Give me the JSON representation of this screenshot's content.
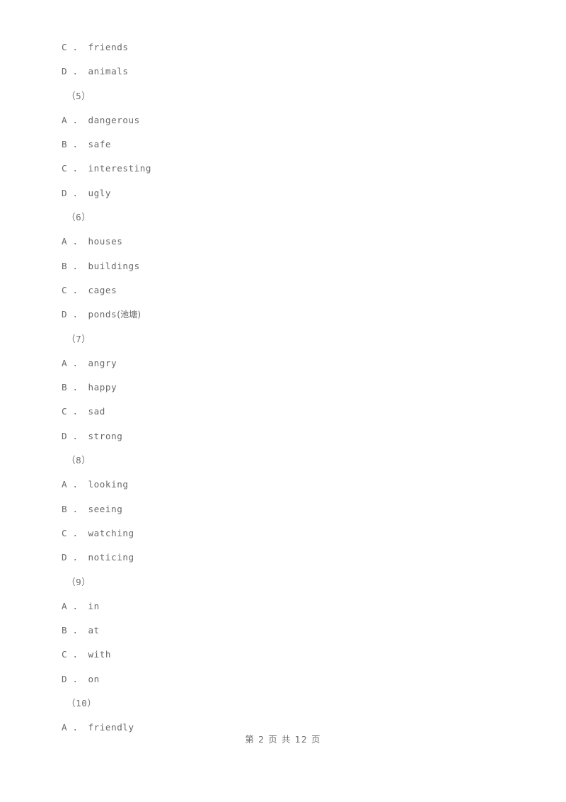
{
  "document": {
    "type": "scanned-exam-worksheet",
    "background_color": "#ffffff",
    "text_color": "#6b6b6b"
  },
  "lines": [
    {
      "kind": "option",
      "text": "C ． friends"
    },
    {
      "kind": "option",
      "text": "D ． animals"
    },
    {
      "kind": "question",
      "text": "（5）"
    },
    {
      "kind": "option",
      "text": "A ． dangerous"
    },
    {
      "kind": "option",
      "text": "B ． safe"
    },
    {
      "kind": "option",
      "text": "C ． interesting"
    },
    {
      "kind": "option",
      "text": "D ． ugly"
    },
    {
      "kind": "question",
      "text": "（6）"
    },
    {
      "kind": "option",
      "text": "A ． houses"
    },
    {
      "kind": "option",
      "text": "B ． buildings"
    },
    {
      "kind": "option",
      "text": "C ． cages"
    },
    {
      "kind": "option",
      "text": "D ． ponds(池塘)"
    },
    {
      "kind": "question",
      "text": "（7）"
    },
    {
      "kind": "option",
      "text": "A ． angry"
    },
    {
      "kind": "option",
      "text": "B ． happy"
    },
    {
      "kind": "option",
      "text": "C ． sad"
    },
    {
      "kind": "option",
      "text": "D ． strong"
    },
    {
      "kind": "question",
      "text": "（8）"
    },
    {
      "kind": "option",
      "text": "A ． looking"
    },
    {
      "kind": "option",
      "text": "B ． seeing"
    },
    {
      "kind": "option",
      "text": "C ． watching"
    },
    {
      "kind": "option",
      "text": "D ． noticing"
    },
    {
      "kind": "question",
      "text": "（9）"
    },
    {
      "kind": "option",
      "text": "A ． in"
    },
    {
      "kind": "option",
      "text": "B ． at"
    },
    {
      "kind": "option",
      "text": "C ． with"
    },
    {
      "kind": "option",
      "text": "D ． on"
    },
    {
      "kind": "question",
      "text": "（10）"
    },
    {
      "kind": "option",
      "text": "A ． friendly"
    }
  ],
  "footer": {
    "page_label": "第 2 页 共 12 页",
    "current_page": "2",
    "total_pages": "12"
  }
}
